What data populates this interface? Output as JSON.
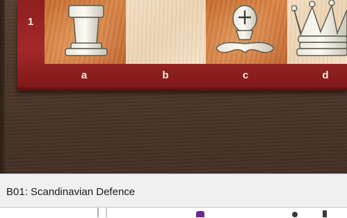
{
  "board": {
    "rank_label": "1",
    "files": [
      "a",
      "b",
      "c",
      "d"
    ],
    "pieces": [
      {
        "square": "a1",
        "name": "white-rook"
      },
      {
        "square": "c1",
        "name": "white-bishop"
      },
      {
        "square": "d1",
        "name": "white-queen"
      }
    ]
  },
  "status": {
    "opening": "B01: Scandinavian Defence"
  },
  "colors": {
    "frame": "#a3292a",
    "dark_square": "#d07a3f",
    "light_square": "#eed8b8",
    "background": "#4a3528",
    "status_bar": "#f0f0f0"
  }
}
